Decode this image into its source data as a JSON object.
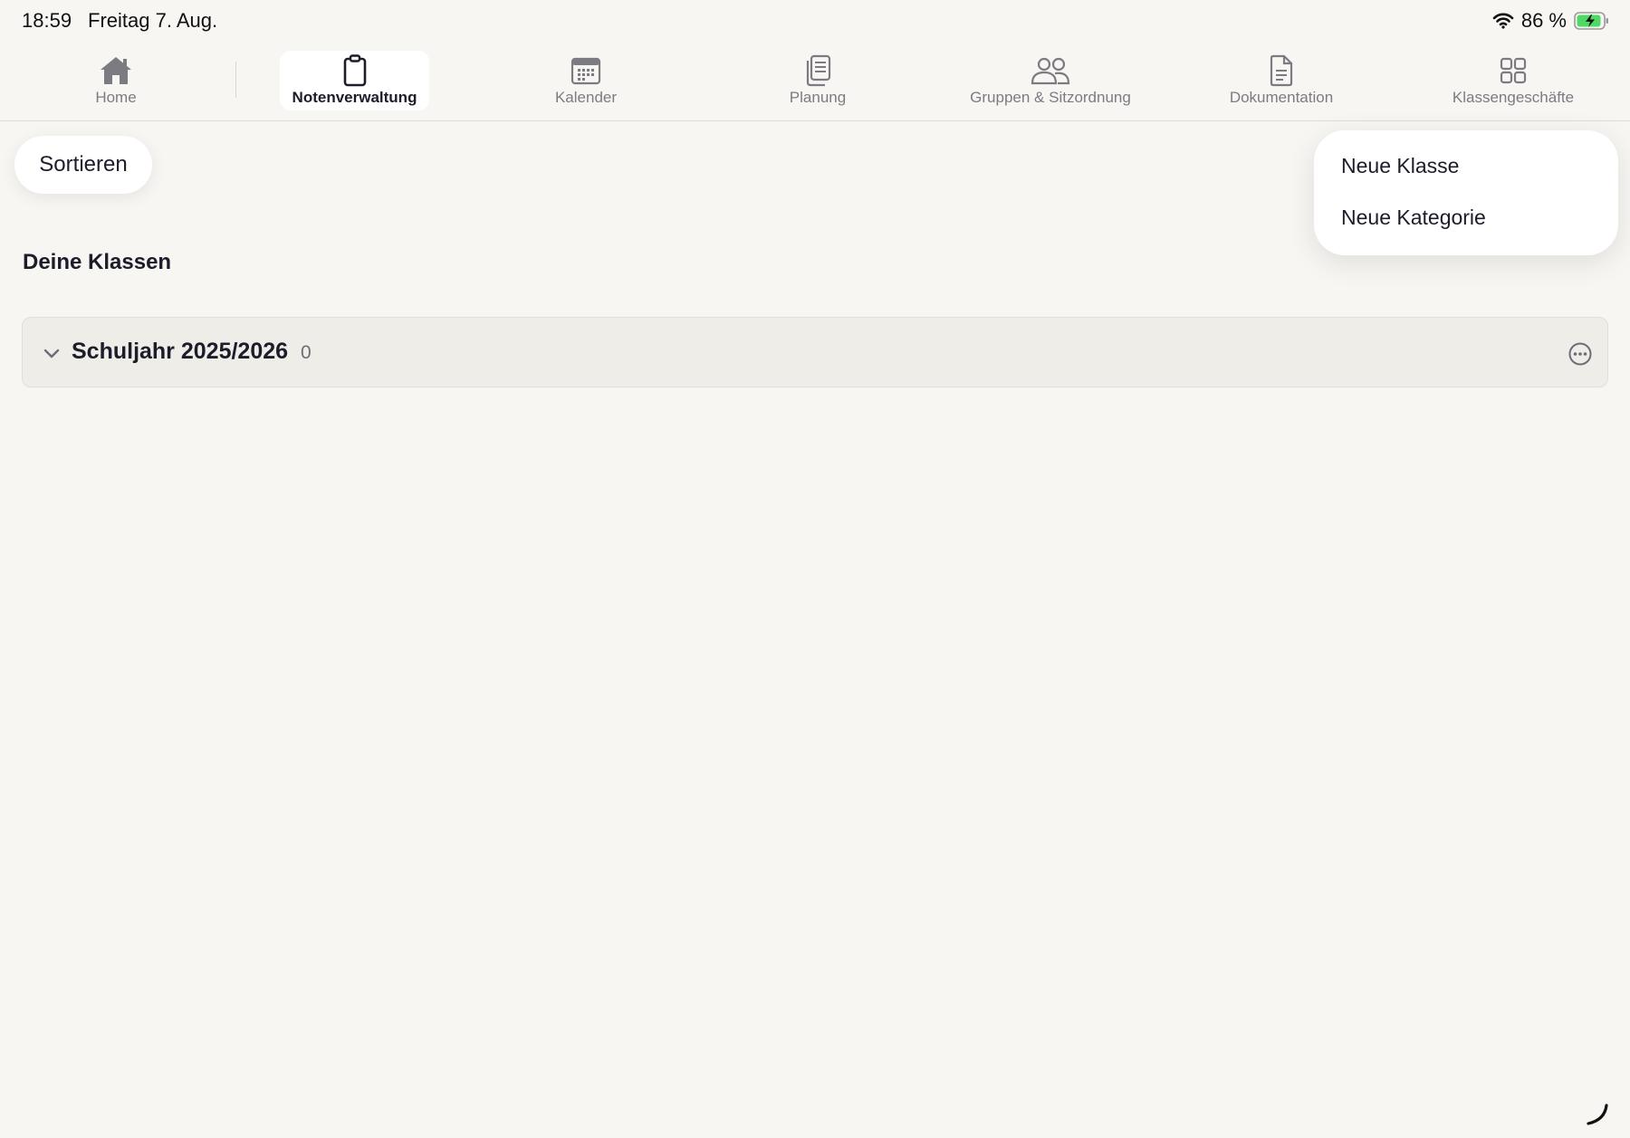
{
  "status_bar": {
    "time": "18:59",
    "date": "Freitag 7. Aug.",
    "battery": "86 %"
  },
  "tabs": [
    {
      "label": "Home",
      "icon": "house-icon",
      "active": false
    },
    {
      "label": "Notenverwaltung",
      "icon": "clipboard-icon",
      "active": true
    },
    {
      "label": "Kalender",
      "icon": "calendar-icon",
      "active": false
    },
    {
      "label": "Planung",
      "icon": "document-pages-icon",
      "active": false
    },
    {
      "label": "Gruppen & Sitzordnung",
      "icon": "people-icon",
      "active": false
    },
    {
      "label": "Dokumentation",
      "icon": "document-icon",
      "active": false
    },
    {
      "label": "Klassengeschäfte",
      "icon": "grid-icon",
      "active": false
    }
  ],
  "toolbar": {
    "sort_label": "Sortieren"
  },
  "menu": {
    "items": [
      "Neue Klasse",
      "Neue Kategorie"
    ]
  },
  "main": {
    "section_title": "Deine Klassen",
    "school_year": {
      "title": "Schuljahr 2025/2026",
      "count": "0"
    }
  },
  "colors": {
    "background": "#f8f6f3",
    "active_tab_bg": "#ffffff",
    "inactive_text": "#7c7b82",
    "primary_text": "#1c1c2a",
    "battery_green": "#4cd964"
  }
}
